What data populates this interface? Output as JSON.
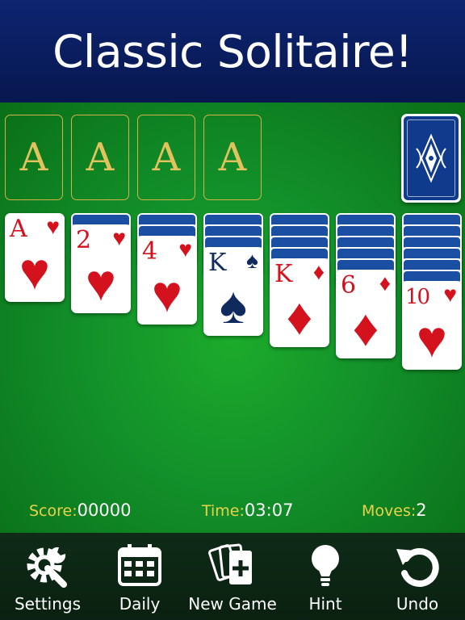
{
  "header": {
    "title": "Classic Solitaire!"
  },
  "foundations": [
    {
      "label": "A"
    },
    {
      "label": "A"
    },
    {
      "label": "A"
    },
    {
      "label": "A"
    }
  ],
  "tableau": [
    {
      "face_down": 0,
      "card": {
        "rank": "A",
        "suit": "♥",
        "color": "red"
      }
    },
    {
      "face_down": 1,
      "card": {
        "rank": "2",
        "suit": "♥",
        "color": "red"
      }
    },
    {
      "face_down": 2,
      "card": {
        "rank": "4",
        "suit": "♥",
        "color": "red"
      }
    },
    {
      "face_down": 3,
      "card": {
        "rank": "K",
        "suit": "♠",
        "color": "black"
      }
    },
    {
      "face_down": 4,
      "card": {
        "rank": "K",
        "suit": "♦",
        "color": "red"
      }
    },
    {
      "face_down": 5,
      "card": {
        "rank": "6",
        "suit": "♦",
        "color": "red"
      }
    },
    {
      "face_down": 6,
      "card": {
        "rank": "10",
        "suit": "♥",
        "color": "red"
      }
    }
  ],
  "stats": {
    "score_label": "Score:",
    "score_value": "00000",
    "time_label": "Time:",
    "time_value": "03:07",
    "moves_label": "Moves:",
    "moves_value": "2"
  },
  "toolbar": {
    "settings": "Settings",
    "daily": "Daily",
    "new_game": "New Game",
    "hint": "Hint",
    "undo": "Undo"
  },
  "icons": [
    "gear-wrench-icon",
    "calendar-icon",
    "new-game-cards-icon",
    "lightbulb-icon",
    "undo-icon"
  ],
  "colors": {
    "banner": "#0d2470",
    "felt": "#12902a",
    "gold": "#e2c25c",
    "card_red": "#d4121e",
    "card_black": "#0f2b5e"
  }
}
